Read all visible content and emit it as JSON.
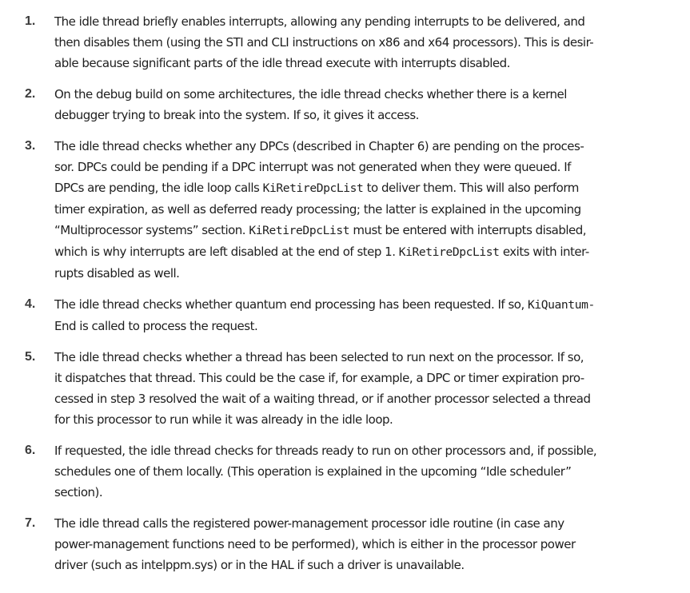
{
  "items": [
    {
      "number": "1.",
      "lines": [
        [
          {
            "t": "The idle thread briefly enables interrupts, allowing any pending interrupts to be delivered, and"
          }
        ],
        [
          {
            "t": "then disables them (using the STI and CLI instructions on x86 and x64 processors). This is desir-"
          }
        ],
        [
          {
            "t": "able because significant parts of the idle thread execute with interrupts disabled."
          }
        ]
      ]
    },
    {
      "number": "2.",
      "lines": [
        [
          {
            "t": "On the debug build on some architectures, the idle thread checks whether there is a kernel"
          }
        ],
        [
          {
            "t": "debugger trying to break into the system. If so, it gives it access."
          }
        ]
      ]
    },
    {
      "number": "3.",
      "lines": [
        [
          {
            "t": "The idle thread checks whether any DPCs (described in Chapter 6) are pending on the proces-"
          }
        ],
        [
          {
            "t": "sor. DPCs could be pending if a DPC interrupt was not generated when they were queued. If"
          }
        ],
        [
          {
            "t": "DPCs are pending, the idle loop calls "
          },
          {
            "t": "KiRetireDpcList",
            "code": true
          },
          {
            "t": " to deliver them. This will also perform"
          }
        ],
        [
          {
            "t": "timer expiration, as well as deferred ready processing; the latter is explained in the upcoming"
          }
        ],
        [
          {
            "t": "“Multiprocessor systems” section. "
          },
          {
            "t": "KiRetireDpcList",
            "code": true
          },
          {
            "t": " must be entered with interrupts disabled,"
          }
        ],
        [
          {
            "t": "which is why interrupts are left disabled at the end of step 1. "
          },
          {
            "t": "KiRetireDpcList",
            "code": true
          },
          {
            "t": " exits with inter-"
          }
        ],
        [
          {
            "t": "rupts disabled as well."
          }
        ]
      ]
    },
    {
      "number": "4.",
      "lines": [
        [
          {
            "t": "The idle thread checks whether quantum end processing has been requested. If so, "
          },
          {
            "t": "KiQuantum-",
            "code": true
          }
        ],
        [
          {
            "t": "End is called to process the request."
          }
        ]
      ]
    },
    {
      "number": "5.",
      "lines": [
        [
          {
            "t": "The idle thread checks whether a thread has been selected to run next on the processor. If so,"
          }
        ],
        [
          {
            "t": "it dispatches that thread. This could be the case if, for example, a DPC or timer expiration pro-"
          }
        ],
        [
          {
            "t": "cessed in step 3 resolved the wait of a waiting thread, or if another processor selected a thread"
          }
        ],
        [
          {
            "t": "for this processor to run while it was already in the idle loop."
          }
        ]
      ]
    },
    {
      "number": "6.",
      "lines": [
        [
          {
            "t": "If requested, the idle thread checks for threads ready to run on other processors and, if possible,"
          }
        ],
        [
          {
            "t": "schedules one of them locally. (This operation is explained in the upcoming “Idle scheduler”"
          }
        ],
        [
          {
            "t": "section)."
          }
        ]
      ]
    },
    {
      "number": "7.",
      "lines": [
        [
          {
            "t": "The idle thread calls the registered power-management processor idle routine (in case any"
          }
        ],
        [
          {
            "t": "power-management functions need to be performed), which is either in the processor power"
          }
        ],
        [
          {
            "t": "driver (such as intelppm.sys) or in the HAL if such a driver is unavailable."
          }
        ]
      ]
    }
  ]
}
